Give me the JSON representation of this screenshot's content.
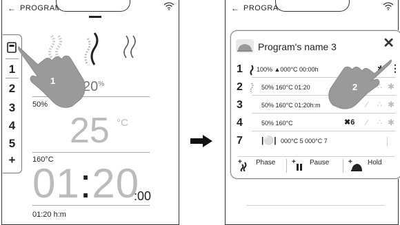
{
  "screen1": {
    "back_icon": "arrow-left-icon",
    "title": "PROGRAM 1",
    "wifi_icon": "wifi-icon",
    "sidebar": {
      "top_icon": "program-card-icon",
      "items": [
        "1",
        "2",
        "3",
        "4",
        "5",
        "+"
      ]
    },
    "steam_pct": "20",
    "steam_pct_unit": "%",
    "humidity_label": "50%",
    "temp_value": "25",
    "temp_unit": "°C",
    "setpoint_label": "160°C",
    "time_main_h": "01",
    "time_colon": ":",
    "time_main_m": "20",
    "time_sec": ":00",
    "time_label": "01:20 h:m",
    "hand_label": "1"
  },
  "transition_icon": "arrow-right-icon",
  "screen2": {
    "back_icon": "arrow-left-icon",
    "title": "PROGRAM 1",
    "wifi_icon": "wifi-icon",
    "dialog": {
      "icon": "program-image-icon",
      "title": "Program's name 3",
      "close_icon": "close-icon",
      "hand_label": "2",
      "rows": [
        {
          "num": "1",
          "text": "100% ▲000°C 00:00h"
        },
        {
          "num": "2",
          "text": "50%   160°C   01:20"
        },
        {
          "num": "3",
          "text": "50%   160°C   01:20h:m",
          "fan": "7"
        },
        {
          "num": "4",
          "text": "50%   160°C",
          "fan": "6"
        },
        {
          "num": "7",
          "text": "000°C 5    000°C    7"
        }
      ],
      "buttons": [
        {
          "label": "Phase",
          "icon": "add-phase-icon"
        },
        {
          "label": "Pause",
          "icon": "add-pause-icon"
        },
        {
          "label": "Hold",
          "icon": "add-hold-icon"
        }
      ]
    }
  }
}
